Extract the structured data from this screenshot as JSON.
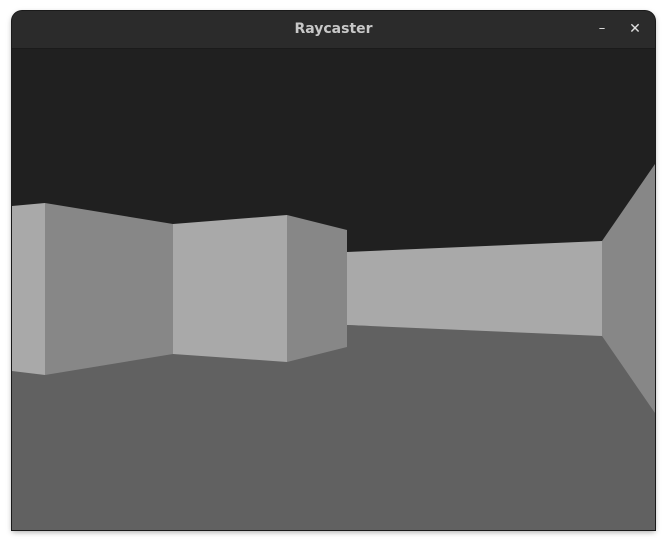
{
  "window": {
    "title": "Raycaster",
    "buttons": {
      "minimize": "–",
      "close": "✕"
    }
  },
  "scene": {
    "ceiling_color": "#202020",
    "floor_color": "#616161",
    "wall_light_color": "#a9a9a9",
    "wall_dark_color": "#878787"
  }
}
